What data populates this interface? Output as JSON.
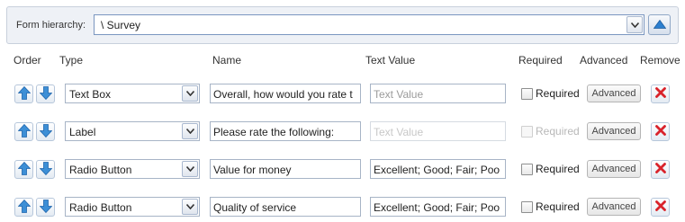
{
  "hierarchy": {
    "label": "Form hierarchy:",
    "value": "\\ Survey",
    "icons": {
      "dropdown": "chevron-down-icon",
      "up": "arrow-up-icon"
    }
  },
  "columns": {
    "order": "Order",
    "type": "Type",
    "name": "Name",
    "text_value": "Text Value",
    "required": "Required",
    "advanced": "Advanced",
    "remove": "Remove"
  },
  "rows": [
    {
      "type": "Text Box",
      "name": "Overall, how would you rate t",
      "text_value": "",
      "text_placeholder": "Text Value",
      "text_disabled": false,
      "required_label": "Required",
      "required_checked": false,
      "required_disabled": false,
      "advanced_label": "Advanced"
    },
    {
      "type": "Label",
      "name": "Please rate the following:",
      "text_value": "",
      "text_placeholder": "Text Value",
      "text_disabled": true,
      "required_label": "Required",
      "required_checked": false,
      "required_disabled": true,
      "advanced_label": "Advanced"
    },
    {
      "type": "Radio Button",
      "name": "Value for money",
      "text_value": "Excellent; Good; Fair; Poo",
      "text_placeholder": "",
      "text_disabled": false,
      "required_label": "Required",
      "required_checked": false,
      "required_disabled": false,
      "advanced_label": "Advanced"
    },
    {
      "type": "Radio Button",
      "name": "Quality of service",
      "text_value": "Excellent; Good; Fair; Poo",
      "text_placeholder": "",
      "text_disabled": false,
      "required_label": "Required",
      "required_checked": false,
      "required_disabled": false,
      "advanced_label": "Advanced"
    }
  ],
  "colors": {
    "arrow_blue": "#3d8fd6",
    "remove_red": "#d9232b",
    "bar_background": "#eef1f6"
  }
}
